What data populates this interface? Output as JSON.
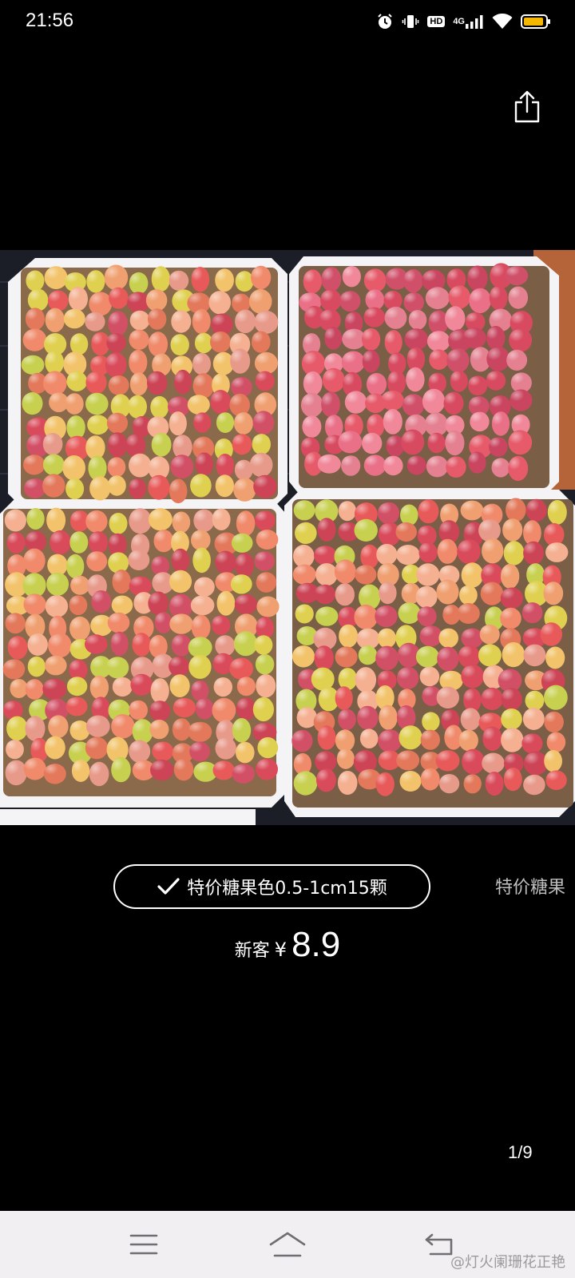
{
  "status_bar": {
    "time": "21:56",
    "hd_badge": "HD",
    "network": "4G",
    "icons": [
      "alarm-icon",
      "vibrate-icon",
      "hd-icon",
      "signal-icon",
      "wifi-icon",
      "battery-icon"
    ]
  },
  "viewer": {
    "share_icon": "share-icon",
    "photo_subject": "four trays of colorful lithops succulents",
    "page_indicator": "1/9"
  },
  "variant": {
    "selected_label": "特价糖果色0.5-1cm15颗",
    "check_icon": "check-icon",
    "next_label": "特价糖果"
  },
  "price": {
    "prefix": "新客",
    "currency": "¥",
    "value": "8.9"
  },
  "nav_bar": {
    "menu_icon": "menu-icon",
    "home_icon": "home-icon",
    "back_icon": "back-icon",
    "watermark": "@灯火阑珊花正艳"
  },
  "colors": {
    "background": "#000000",
    "nav_background": "#f1eff2",
    "accent_text": "#ffffff",
    "muted_text": "#bfbfbf",
    "battery": "#f5b800"
  }
}
